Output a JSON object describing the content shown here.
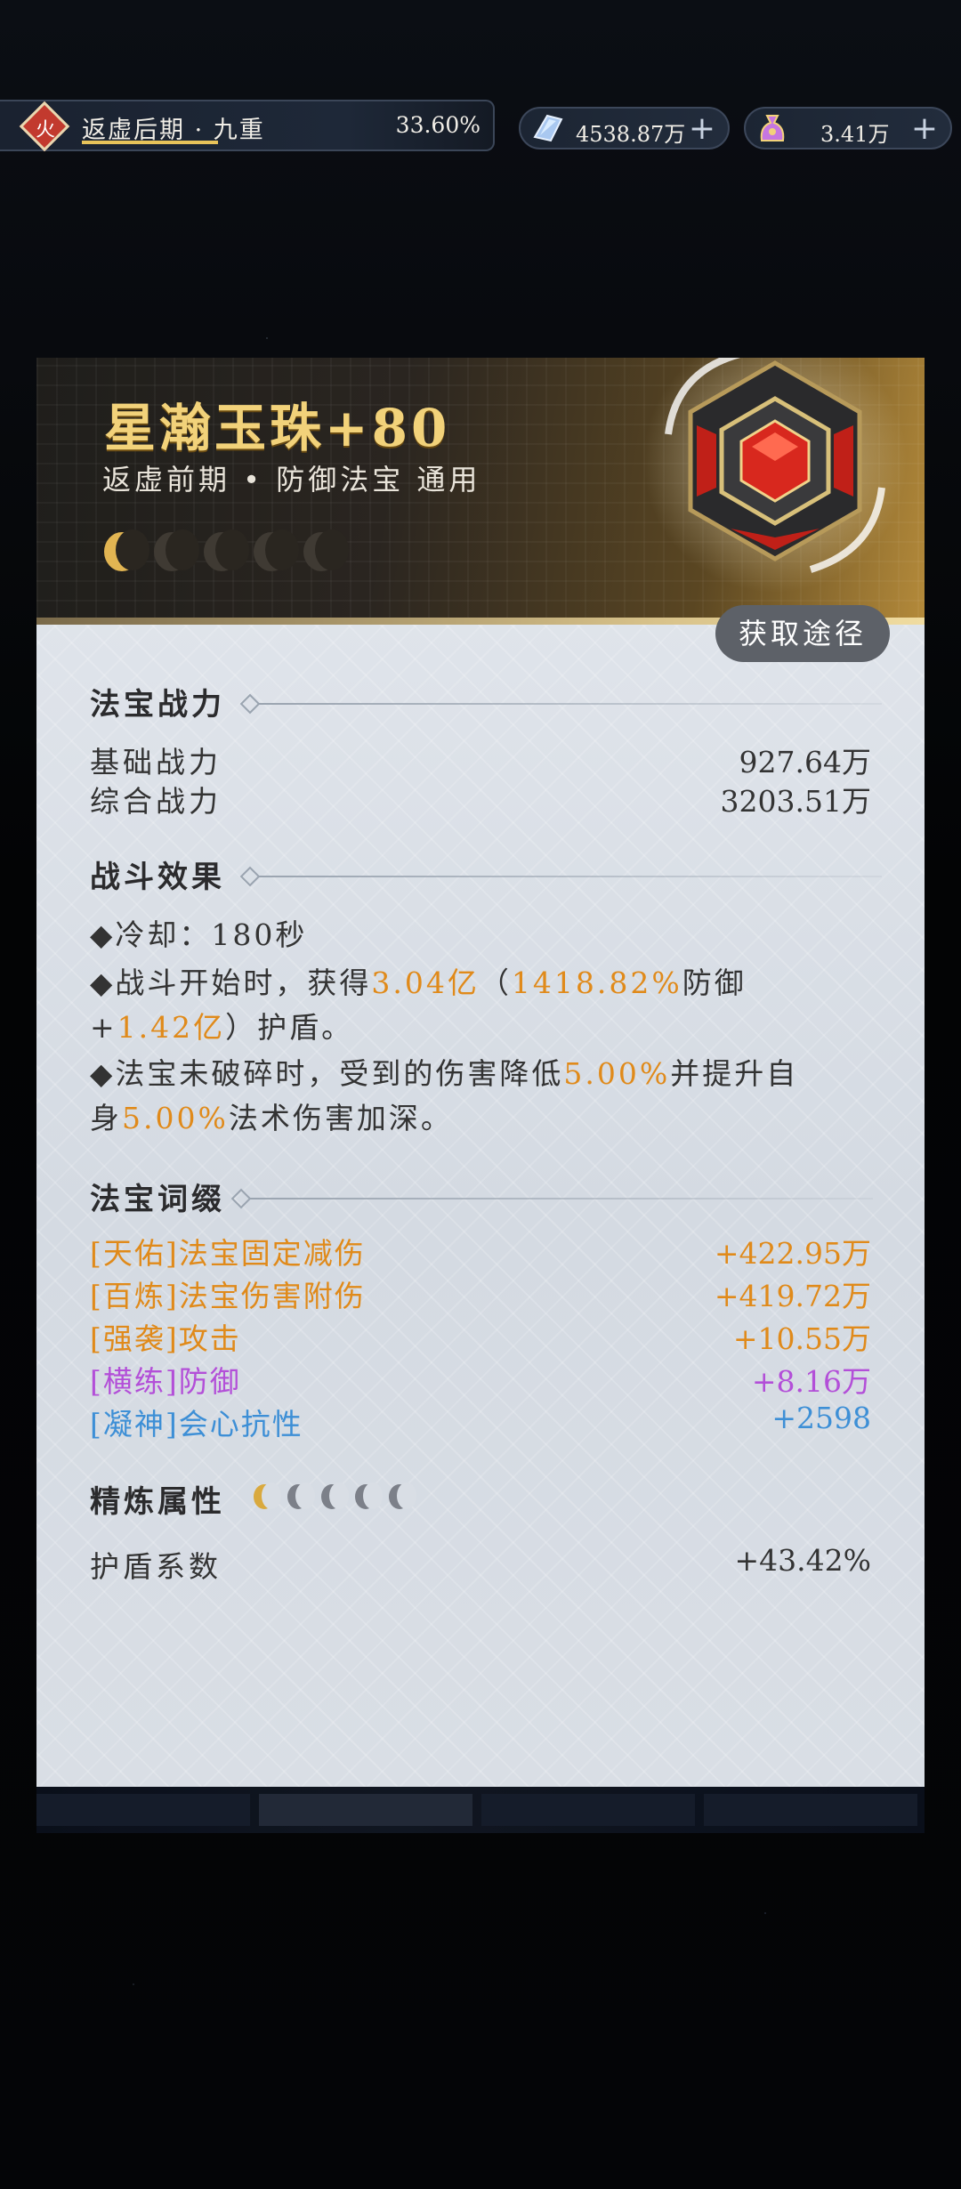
{
  "topbar": {
    "element_badge": "火",
    "realm": "返虚后期 · 九重",
    "realm_percent": "33.60%",
    "realm_progress": 0.336,
    "currency1": {
      "icon": "spirit-stone-icon",
      "value": "4538.87万",
      "plus": "+"
    },
    "currency2": {
      "icon": "wish-pouch-icon",
      "value": "3.41万",
      "plus": "+"
    }
  },
  "item": {
    "name": "星瀚玉珠+80",
    "subtitle": "返虚前期 • 防御法宝  通用",
    "moons_lit": 1,
    "moons_total": 5,
    "icon": "jade-orb-icon"
  },
  "acquire_button": "获取途径",
  "power": {
    "title": "法宝战力",
    "rows": [
      {
        "label": "基础战力",
        "value": "927.64万"
      },
      {
        "label": "综合战力",
        "value": "3203.51万"
      }
    ]
  },
  "combat": {
    "title": "战斗效果",
    "line1": "◆冷却：180秒",
    "line2_a": "◆战斗开始时，获得",
    "line2_b": "3.04亿",
    "line2_c": "（",
    "line2_d": "1418.82%",
    "line2_e": "防御",
    "line3_a": "+",
    "line3_b": "1.42亿",
    "line3_c": "）护盾。",
    "line4_a": "◆法宝未破碎时，受到的伤害降低",
    "line4_b": "5.00%",
    "line4_c": "并提升自",
    "line5_a": "身",
    "line5_b": "5.00%",
    "line5_c": "法术伤害加深。"
  },
  "affixes": {
    "title": "法宝词缀",
    "items": [
      {
        "label": "[天佑]法宝固定减伤",
        "value": "+422.95万",
        "color": "#e08a1a"
      },
      {
        "label": "[百炼]法宝伤害附伤",
        "value": "+419.72万",
        "color": "#e08a1a"
      },
      {
        "label": "[强袭]攻击",
        "value": "+10.55万",
        "color": "#e08a1a"
      },
      {
        "label": "[横练]防御",
        "value": "+8.16万",
        "color": "#b34fd8"
      },
      {
        "label": "[凝神]会心抗性",
        "value": "+2598",
        "color": "#3d8fd6"
      }
    ]
  },
  "refine": {
    "title": "精炼属性",
    "moons_lit": 1,
    "moons_total": 5,
    "rows": [
      {
        "label": "护盾系数",
        "value": "+43.42%"
      }
    ]
  }
}
